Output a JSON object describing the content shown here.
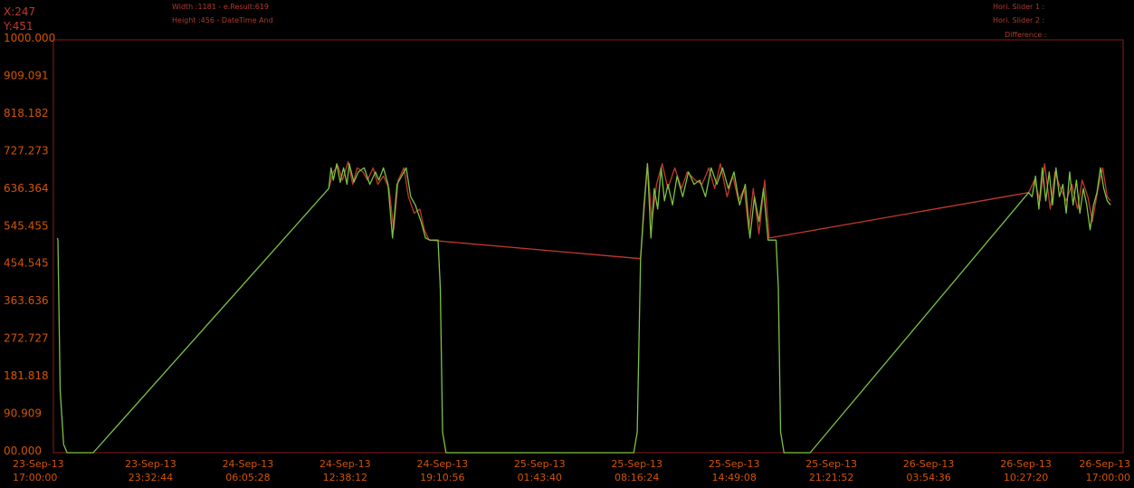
{
  "readout": {
    "x": "X:247",
    "y": "Y:451"
  },
  "info": {
    "width_line": "Width :1181 - e.Result:619",
    "height_line": "Height :456 - DateTime And"
  },
  "sliders": {
    "slider1": "Hori. Slider 1 :",
    "slider2": "Hori. Slider 2 :",
    "difference": "Difference :"
  },
  "colors": {
    "axis": "#8b1a1a",
    "label": "#d35400",
    "series_green": "#7cc242",
    "series_red": "#c0392b"
  },
  "chart_data": {
    "type": "line",
    "ylim": [
      0,
      1000
    ],
    "y_ticks": [
      "1000.000",
      "909.091",
      "818.182",
      "727.273",
      "636.364",
      "545.455",
      "454.545",
      "363.636",
      "272.727",
      "181.818",
      "90.909",
      "00.000"
    ],
    "x_ticks": [
      [
        "23-Sep-13",
        "17:00:00"
      ],
      [
        "23-Sep-13",
        "23:32:44"
      ],
      [
        "24-Sep-13",
        "06:05:28"
      ],
      [
        "24-Sep-13",
        "12:38:12"
      ],
      [
        "24-Sep-13",
        "19:10:56"
      ],
      [
        "25-Sep-13",
        "01:43:40"
      ],
      [
        "25-Sep-13",
        "08:16:24"
      ],
      [
        "25-Sep-13",
        "14:49:08"
      ],
      [
        "25-Sep-13",
        "21:21:52"
      ],
      [
        "26-Sep-13",
        "03:54:36"
      ],
      [
        "26-Sep-13",
        "10:27:20"
      ],
      [
        "26-Sep-13",
        "17:00:00"
      ]
    ],
    "series": [
      {
        "values": [
          [
            0.35,
            520
          ],
          [
            0.4,
            515
          ],
          [
            0.6,
            150
          ],
          [
            0.9,
            20
          ],
          [
            1.2,
            0
          ],
          [
            3.5,
            0
          ],
          [
            24.2,
            640
          ],
          [
            24.4,
            690
          ],
          [
            24.6,
            660
          ],
          [
            24.9,
            700
          ],
          [
            25.2,
            655
          ],
          [
            25.5,
            690
          ],
          [
            25.8,
            650
          ],
          [
            26.0,
            700
          ],
          [
            26.4,
            655
          ],
          [
            26.8,
            680
          ],
          [
            27.3,
            690
          ],
          [
            27.8,
            650
          ],
          [
            28.3,
            680
          ],
          [
            28.6,
            660
          ],
          [
            29.0,
            690
          ],
          [
            29.4,
            650
          ],
          [
            29.8,
            520
          ],
          [
            30.2,
            650
          ],
          [
            30.6,
            670
          ],
          [
            31.0,
            690
          ],
          [
            31.4,
            620
          ],
          [
            31.8,
            600
          ],
          [
            32.3,
            560
          ],
          [
            32.7,
            520
          ],
          [
            33.1,
            515
          ],
          [
            33.6,
            515
          ],
          [
            33.8,
            515
          ],
          [
            34.0,
            400
          ],
          [
            34.2,
            50
          ],
          [
            34.5,
            0
          ],
          [
            51.0,
            0
          ],
          [
            51.3,
            50
          ],
          [
            51.6,
            470
          ],
          [
            51.9,
            600
          ],
          [
            52.2,
            700
          ],
          [
            52.5,
            520
          ],
          [
            52.8,
            640
          ],
          [
            53.1,
            590
          ],
          [
            53.4,
            690
          ],
          [
            53.7,
            610
          ],
          [
            54.0,
            650
          ],
          [
            54.4,
            600
          ],
          [
            54.8,
            670
          ],
          [
            55.3,
            620
          ],
          [
            55.8,
            680
          ],
          [
            56.3,
            650
          ],
          [
            56.8,
            660
          ],
          [
            57.3,
            620
          ],
          [
            57.8,
            690
          ],
          [
            58.3,
            650
          ],
          [
            58.8,
            690
          ],
          [
            59.3,
            640
          ],
          [
            59.8,
            680
          ],
          [
            60.3,
            600
          ],
          [
            60.8,
            650
          ],
          [
            61.2,
            520
          ],
          [
            61.6,
            620
          ],
          [
            62.0,
            560
          ],
          [
            62.4,
            640
          ],
          [
            62.8,
            515
          ],
          [
            63.3,
            515
          ],
          [
            63.5,
            515
          ],
          [
            63.7,
            400
          ],
          [
            63.9,
            50
          ],
          [
            64.2,
            0
          ],
          [
            66.5,
            0
          ],
          [
            85.7,
            630
          ],
          [
            86.0,
            620
          ],
          [
            86.3,
            670
          ],
          [
            86.6,
            590
          ],
          [
            86.9,
            690
          ],
          [
            87.2,
            610
          ],
          [
            87.5,
            680
          ],
          [
            87.8,
            600
          ],
          [
            88.1,
            690
          ],
          [
            88.4,
            620
          ],
          [
            88.7,
            650
          ],
          [
            89.0,
            580
          ],
          [
            89.3,
            680
          ],
          [
            89.6,
            600
          ],
          [
            89.9,
            660
          ],
          [
            90.2,
            580
          ],
          [
            90.5,
            640
          ],
          [
            90.8,
            600
          ],
          [
            91.1,
            540
          ],
          [
            91.4,
            600
          ],
          [
            91.7,
            630
          ],
          [
            92.0,
            690
          ],
          [
            92.3,
            640
          ],
          [
            92.6,
            610
          ],
          [
            92.9,
            600
          ]
        ]
      },
      {
        "values": [
          [
            24.2,
            640
          ],
          [
            24.6,
            680
          ],
          [
            25.0,
            695
          ],
          [
            25.4,
            660
          ],
          [
            25.9,
            705
          ],
          [
            26.3,
            650
          ],
          [
            26.7,
            690
          ],
          [
            27.2,
            680
          ],
          [
            27.6,
            660
          ],
          [
            28.1,
            690
          ],
          [
            28.5,
            650
          ],
          [
            29.0,
            670
          ],
          [
            29.5,
            640
          ],
          [
            29.9,
            540
          ],
          [
            30.3,
            660
          ],
          [
            30.8,
            690
          ],
          [
            31.2,
            620
          ],
          [
            31.7,
            580
          ],
          [
            32.2,
            590
          ],
          [
            32.6,
            540
          ],
          [
            33.0,
            515
          ],
          [
            51.6,
            470
          ],
          [
            52.2,
            700
          ],
          [
            52.6,
            560
          ],
          [
            53.0,
            650
          ],
          [
            53.5,
            700
          ],
          [
            54.0,
            640
          ],
          [
            54.6,
            690
          ],
          [
            55.2,
            640
          ],
          [
            55.7,
            680
          ],
          [
            56.4,
            660
          ],
          [
            57.0,
            650
          ],
          [
            57.6,
            690
          ],
          [
            58.1,
            640
          ],
          [
            58.6,
            700
          ],
          [
            59.2,
            620
          ],
          [
            59.7,
            670
          ],
          [
            60.2,
            610
          ],
          [
            60.7,
            640
          ],
          [
            61.1,
            540
          ],
          [
            61.5,
            640
          ],
          [
            62.0,
            530
          ],
          [
            62.5,
            660
          ],
          [
            62.9,
            520
          ],
          [
            85.7,
            630
          ],
          [
            86.2,
            660
          ],
          [
            86.7,
            610
          ],
          [
            87.1,
            700
          ],
          [
            87.6,
            590
          ],
          [
            88.0,
            680
          ],
          [
            88.5,
            640
          ],
          [
            89.0,
            610
          ],
          [
            89.5,
            650
          ],
          [
            90.0,
            590
          ],
          [
            90.4,
            660
          ],
          [
            90.9,
            620
          ],
          [
            91.3,
            560
          ],
          [
            91.8,
            640
          ],
          [
            92.2,
            690
          ],
          [
            92.6,
            620
          ],
          [
            92.9,
            610
          ]
        ]
      }
    ]
  }
}
